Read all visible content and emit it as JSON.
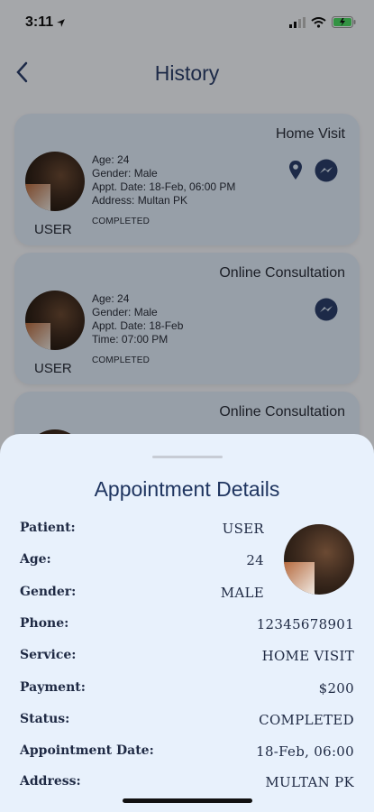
{
  "status_bar": {
    "time": "3:11"
  },
  "header": {
    "title": "History"
  },
  "cards": [
    {
      "service": "Home Visit",
      "user": "USER",
      "details": [
        "Age: 24",
        "Gender: Male",
        "Appt. Date: 18-Feb, 06:00 PM",
        "Address: Multan PK"
      ],
      "status": "COMPLETED"
    },
    {
      "service": "Online Consultation",
      "user": "USER",
      "details": [
        "Age: 24",
        "Gender: Male",
        "Appt. Date: 18-Feb",
        "Time: 07:00 PM"
      ],
      "status": "COMPLETED"
    },
    {
      "service": "Online Consultation"
    }
  ],
  "sheet": {
    "title": "Appointment Details",
    "rows": [
      {
        "label": "Patient:",
        "value": "USER"
      },
      {
        "label": "Age:",
        "value": "24"
      },
      {
        "label": "Gender:",
        "value": "MALE"
      },
      {
        "label": "Phone:",
        "value": "12345678901"
      },
      {
        "label": "Service:",
        "value": "HOME VISIT"
      },
      {
        "label": "Payment:",
        "value": "$200"
      },
      {
        "label": "Status:",
        "value": "COMPLETED"
      },
      {
        "label": "Appointment Date:",
        "value": "18-Feb, 06:00"
      },
      {
        "label": "Address:",
        "value": "MULTAN PK"
      }
    ]
  },
  "colors": {
    "accent": "#2b3f6b",
    "card_bg": "#dfeaf8",
    "sheet_bg": "#e8f1fc"
  },
  "icons": [
    "location-arrow-icon",
    "signal-icon",
    "wifi-icon",
    "battery-icon",
    "back-chevron-icon",
    "map-pin-icon",
    "messenger-icon"
  ]
}
